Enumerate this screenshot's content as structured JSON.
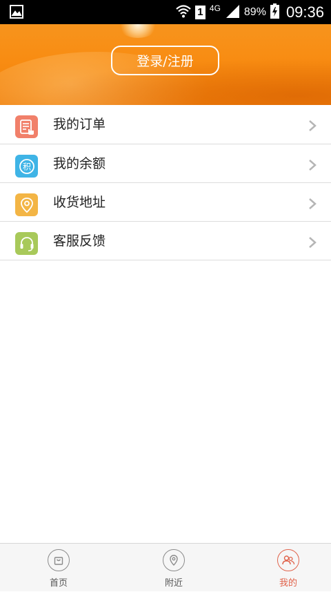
{
  "status_bar": {
    "sim_slot": "1",
    "network": "4G",
    "battery": "89%",
    "time": "09:36"
  },
  "header": {
    "login_label": "登录/注册"
  },
  "menu": {
    "items": [
      {
        "label": "我的订单",
        "icon": "order-icon",
        "color": "#f1806a"
      },
      {
        "label": "我的余额",
        "icon": "balance-icon",
        "color": "#3fb4e6",
        "icon_text": "积"
      },
      {
        "label": "收货地址",
        "icon": "location-icon",
        "color": "#f3b545"
      },
      {
        "label": "客服反馈",
        "icon": "headset-icon",
        "color": "#a8c95a"
      }
    ]
  },
  "tab_bar": {
    "tabs": [
      {
        "label": "首页",
        "icon": "shopping-bag-icon",
        "active": false
      },
      {
        "label": "附近",
        "icon": "map-pin-icon",
        "active": false
      },
      {
        "label": "我的",
        "icon": "users-icon",
        "active": true
      }
    ],
    "active_color": "#e0624a"
  }
}
